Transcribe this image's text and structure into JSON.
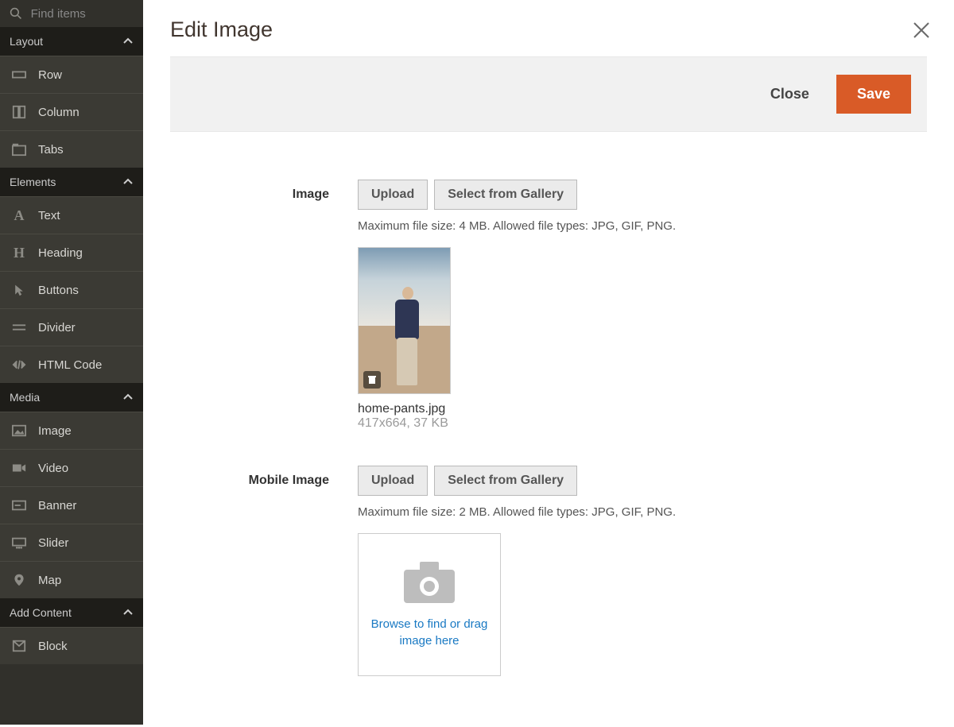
{
  "sidebar": {
    "search_placeholder": "Find items",
    "sections": {
      "layout": {
        "label": "Layout",
        "items": [
          {
            "label": "Row"
          },
          {
            "label": "Column"
          },
          {
            "label": "Tabs"
          }
        ]
      },
      "elements": {
        "label": "Elements",
        "items": [
          {
            "label": "Text"
          },
          {
            "label": "Heading"
          },
          {
            "label": "Buttons"
          },
          {
            "label": "Divider"
          },
          {
            "label": "HTML Code"
          }
        ]
      },
      "media": {
        "label": "Media",
        "items": [
          {
            "label": "Image"
          },
          {
            "label": "Video"
          },
          {
            "label": "Banner"
          },
          {
            "label": "Slider"
          },
          {
            "label": "Map"
          }
        ]
      },
      "add_content": {
        "label": "Add Content",
        "items": [
          {
            "label": "Block"
          }
        ]
      }
    }
  },
  "modal": {
    "title": "Edit Image",
    "close": "Close",
    "save": "Save"
  },
  "image_field": {
    "label": "Image",
    "upload": "Upload",
    "gallery": "Select from Gallery",
    "hint": "Maximum file size: 4 MB. Allowed file types: JPG, GIF, PNG.",
    "file_name": "home-pants.jpg",
    "file_meta": "417x664, 37 KB"
  },
  "mobile_field": {
    "label": "Mobile Image",
    "upload": "Upload",
    "gallery": "Select from Gallery",
    "hint": "Maximum file size: 2 MB. Allowed file types: JPG, GIF, PNG.",
    "dropzone": "Browse to find or drag image here"
  }
}
